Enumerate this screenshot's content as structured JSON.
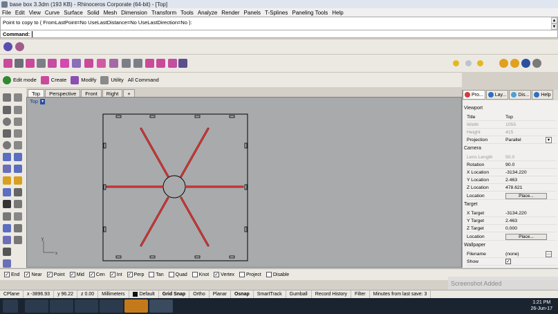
{
  "window": {
    "title": "base box 3.3dm (193 KB) - Rhinoceros Corporate (64-bit) - [Top]"
  },
  "menu": [
    "File",
    "Edit",
    "View",
    "Curve",
    "Surface",
    "Solid",
    "Mesh",
    "Dimension",
    "Transform",
    "Tools",
    "Analyze",
    "Render",
    "Panels",
    "T-Splines",
    "Paneling Tools",
    "Help"
  ],
  "command": {
    "history": "Point to copy to ( FromLastPoint=No  UseLastDistance=No  UseLastDirection=No ):",
    "prompt": "Command:"
  },
  "toolbar3": {
    "edit_mode": "Edit mode",
    "create": "Create",
    "modify": "Modify",
    "utility": "Utility",
    "all_command": "All Command"
  },
  "viewport_tabs": [
    "Top",
    "Perspective",
    "Front",
    "Right"
  ],
  "viewport": {
    "label": "Top",
    "axis_x": "x",
    "axis_y": "y"
  },
  "properties": {
    "tabs": [
      "Pro...",
      "Lay...",
      "Dis...",
      "Help"
    ],
    "viewport_section": "Viewport",
    "title_label": "Title",
    "title_value": "Top",
    "width_label": "Width",
    "width_value": "1055",
    "height_label": "Height",
    "height_value": "415",
    "projection_label": "Projection",
    "projection_value": "Parallel",
    "camera_section": "Camera",
    "lens_label": "Lens Length",
    "lens_value": "50.0",
    "rotation_label": "Rotation",
    "rotation_value": "90.0",
    "xloc_label": "X Location",
    "xloc_value": "-3134.220",
    "yloc_label": "Y Location",
    "yloc_value": "2.463",
    "zloc_label": "Z Location",
    "zloc_value": "478.621",
    "location_label": "Location",
    "place_button": "Place...",
    "target_section": "Target",
    "xt_label": "X Target",
    "xt_value": "-3134.220",
    "yt_label": "Y Target",
    "yt_value": "2.463",
    "zt_label": "Z Target",
    "zt_value": "0.000",
    "tlocation_label": "Location",
    "wallpaper_section": "Wallpaper",
    "filename_label": "Filename",
    "filename_value": "(none)",
    "show_label": "Show"
  },
  "osnaps": [
    {
      "label": "End",
      "checked": true
    },
    {
      "label": "Near",
      "checked": true
    },
    {
      "label": "Point",
      "checked": true
    },
    {
      "label": "Mid",
      "checked": true
    },
    {
      "label": "Cen",
      "checked": true
    },
    {
      "label": "Int",
      "checked": true
    },
    {
      "label": "Perp",
      "checked": true
    },
    {
      "label": "Tan",
      "checked": false
    },
    {
      "label": "Quad",
      "checked": false
    },
    {
      "label": "Knot",
      "checked": false
    },
    {
      "label": "Vertex",
      "checked": true
    },
    {
      "label": "Project",
      "checked": false
    },
    {
      "label": "Disable",
      "checked": false
    }
  ],
  "status": {
    "cplane": "CPlane",
    "x": "x -3896.93",
    "y": "y 96.22",
    "z": "z 0.00",
    "units": "Millimeters",
    "layer": "Default",
    "grid_snap": "Grid Snap",
    "ortho": "Ortho",
    "planar": "Planar",
    "osnap": "Osnap",
    "smarttrack": "SmartTrack",
    "gumball": "Gumball",
    "record_history": "Record History",
    "filter": "Filter",
    "last_save": "Minutes from last save: 3"
  },
  "toast": "Screenshot Added",
  "clock": {
    "time": "1:21 PM",
    "date": "26-Jun-17"
  },
  "colors": {
    "curve": "#d42a2a",
    "viewport_bg": "#a8aaac",
    "outline": "#000000"
  }
}
